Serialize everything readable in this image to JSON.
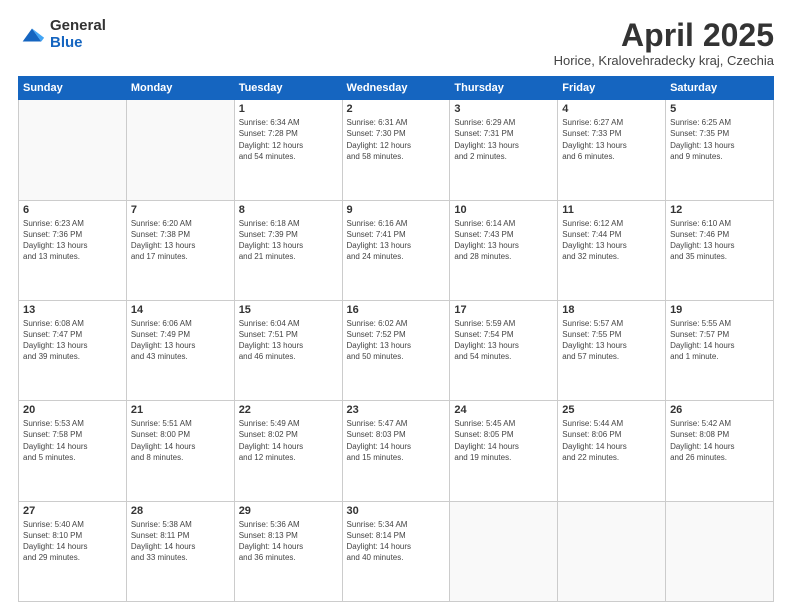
{
  "logo": {
    "general": "General",
    "blue": "Blue"
  },
  "title": "April 2025",
  "subtitle": "Horice, Kralovehradecky kraj, Czechia",
  "headers": [
    "Sunday",
    "Monday",
    "Tuesday",
    "Wednesday",
    "Thursday",
    "Friday",
    "Saturday"
  ],
  "weeks": [
    [
      {
        "day": "",
        "info": ""
      },
      {
        "day": "",
        "info": ""
      },
      {
        "day": "1",
        "info": "Sunrise: 6:34 AM\nSunset: 7:28 PM\nDaylight: 12 hours\nand 54 minutes."
      },
      {
        "day": "2",
        "info": "Sunrise: 6:31 AM\nSunset: 7:30 PM\nDaylight: 12 hours\nand 58 minutes."
      },
      {
        "day": "3",
        "info": "Sunrise: 6:29 AM\nSunset: 7:31 PM\nDaylight: 13 hours\nand 2 minutes."
      },
      {
        "day": "4",
        "info": "Sunrise: 6:27 AM\nSunset: 7:33 PM\nDaylight: 13 hours\nand 6 minutes."
      },
      {
        "day": "5",
        "info": "Sunrise: 6:25 AM\nSunset: 7:35 PM\nDaylight: 13 hours\nand 9 minutes."
      }
    ],
    [
      {
        "day": "6",
        "info": "Sunrise: 6:23 AM\nSunset: 7:36 PM\nDaylight: 13 hours\nand 13 minutes."
      },
      {
        "day": "7",
        "info": "Sunrise: 6:20 AM\nSunset: 7:38 PM\nDaylight: 13 hours\nand 17 minutes."
      },
      {
        "day": "8",
        "info": "Sunrise: 6:18 AM\nSunset: 7:39 PM\nDaylight: 13 hours\nand 21 minutes."
      },
      {
        "day": "9",
        "info": "Sunrise: 6:16 AM\nSunset: 7:41 PM\nDaylight: 13 hours\nand 24 minutes."
      },
      {
        "day": "10",
        "info": "Sunrise: 6:14 AM\nSunset: 7:43 PM\nDaylight: 13 hours\nand 28 minutes."
      },
      {
        "day": "11",
        "info": "Sunrise: 6:12 AM\nSunset: 7:44 PM\nDaylight: 13 hours\nand 32 minutes."
      },
      {
        "day": "12",
        "info": "Sunrise: 6:10 AM\nSunset: 7:46 PM\nDaylight: 13 hours\nand 35 minutes."
      }
    ],
    [
      {
        "day": "13",
        "info": "Sunrise: 6:08 AM\nSunset: 7:47 PM\nDaylight: 13 hours\nand 39 minutes."
      },
      {
        "day": "14",
        "info": "Sunrise: 6:06 AM\nSunset: 7:49 PM\nDaylight: 13 hours\nand 43 minutes."
      },
      {
        "day": "15",
        "info": "Sunrise: 6:04 AM\nSunset: 7:51 PM\nDaylight: 13 hours\nand 46 minutes."
      },
      {
        "day": "16",
        "info": "Sunrise: 6:02 AM\nSunset: 7:52 PM\nDaylight: 13 hours\nand 50 minutes."
      },
      {
        "day": "17",
        "info": "Sunrise: 5:59 AM\nSunset: 7:54 PM\nDaylight: 13 hours\nand 54 minutes."
      },
      {
        "day": "18",
        "info": "Sunrise: 5:57 AM\nSunset: 7:55 PM\nDaylight: 13 hours\nand 57 minutes."
      },
      {
        "day": "19",
        "info": "Sunrise: 5:55 AM\nSunset: 7:57 PM\nDaylight: 14 hours\nand 1 minute."
      }
    ],
    [
      {
        "day": "20",
        "info": "Sunrise: 5:53 AM\nSunset: 7:58 PM\nDaylight: 14 hours\nand 5 minutes."
      },
      {
        "day": "21",
        "info": "Sunrise: 5:51 AM\nSunset: 8:00 PM\nDaylight: 14 hours\nand 8 minutes."
      },
      {
        "day": "22",
        "info": "Sunrise: 5:49 AM\nSunset: 8:02 PM\nDaylight: 14 hours\nand 12 minutes."
      },
      {
        "day": "23",
        "info": "Sunrise: 5:47 AM\nSunset: 8:03 PM\nDaylight: 14 hours\nand 15 minutes."
      },
      {
        "day": "24",
        "info": "Sunrise: 5:45 AM\nSunset: 8:05 PM\nDaylight: 14 hours\nand 19 minutes."
      },
      {
        "day": "25",
        "info": "Sunrise: 5:44 AM\nSunset: 8:06 PM\nDaylight: 14 hours\nand 22 minutes."
      },
      {
        "day": "26",
        "info": "Sunrise: 5:42 AM\nSunset: 8:08 PM\nDaylight: 14 hours\nand 26 minutes."
      }
    ],
    [
      {
        "day": "27",
        "info": "Sunrise: 5:40 AM\nSunset: 8:10 PM\nDaylight: 14 hours\nand 29 minutes."
      },
      {
        "day": "28",
        "info": "Sunrise: 5:38 AM\nSunset: 8:11 PM\nDaylight: 14 hours\nand 33 minutes."
      },
      {
        "day": "29",
        "info": "Sunrise: 5:36 AM\nSunset: 8:13 PM\nDaylight: 14 hours\nand 36 minutes."
      },
      {
        "day": "30",
        "info": "Sunrise: 5:34 AM\nSunset: 8:14 PM\nDaylight: 14 hours\nand 40 minutes."
      },
      {
        "day": "",
        "info": ""
      },
      {
        "day": "",
        "info": ""
      },
      {
        "day": "",
        "info": ""
      }
    ]
  ]
}
